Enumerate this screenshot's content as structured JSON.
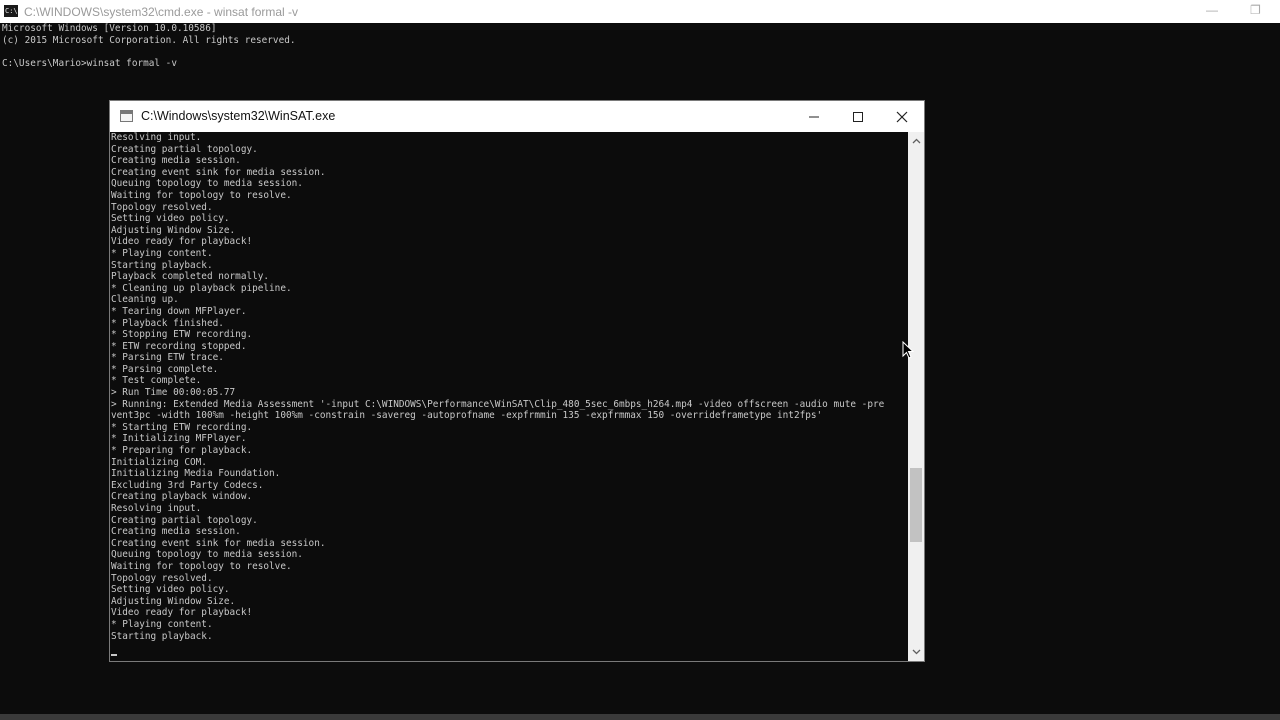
{
  "cmd_window": {
    "title": "C:\\WINDOWS\\system32\\cmd.exe - winsat  formal -v",
    "icon_text": "C:\\",
    "lines": [
      "Microsoft Windows [Version 10.0.10586]",
      "(c) 2015 Microsoft Corporation. All rights reserved.",
      "",
      "C:\\Users\\Mario>winsat formal -v"
    ],
    "controls": {
      "minimize": "—",
      "restore": "❐"
    }
  },
  "winsat_window": {
    "title": "C:\\Windows\\system32\\WinSAT.exe",
    "controls": {
      "minimize": "minimize",
      "maximize": "maximize",
      "close": "close"
    },
    "output_lines": [
      "Resolving input.",
      "Creating partial topology.",
      "Creating media session.",
      "Creating event sink for media session.",
      "Queuing topology to media session.",
      "Waiting for topology to resolve.",
      "Topology resolved.",
      "Setting video policy.",
      "Adjusting Window Size.",
      "Video ready for playback!",
      "* Playing content.",
      "Starting playback.",
      "Playback completed normally.",
      "* Cleaning up playback pipeline.",
      "Cleaning up.",
      "* Tearing down MFPlayer.",
      "* Playback finished.",
      "* Stopping ETW recording.",
      "* ETW recording stopped.",
      "* Parsing ETW trace.",
      "* Parsing complete.",
      "* Test complete.",
      "> Run Time 00:00:05.77",
      "> Running: Extended Media Assessment '-input C:\\WINDOWS\\Performance\\WinSAT\\Clip_480_5sec_6mbps_h264.mp4 -video offscreen -audio mute -pre",
      "vent3pc -width 100%m -height 100%m -constrain -savereg -autoprofname -expfrmmin 135 -expfrmmax 150 -overrideframetype int2fps'",
      "* Starting ETW recording.",
      "* Initializing MFPlayer.",
      "* Preparing for playback.",
      "Initializing COM.",
      "Initializing Media Foundation.",
      "Excluding 3rd Party Codecs.",
      "Creating playback window.",
      "Resolving input.",
      "Creating partial topology.",
      "Creating media session.",
      "Creating event sink for media session.",
      "Queuing topology to media session.",
      "Waiting for topology to resolve.",
      "Topology resolved.",
      "Setting video policy.",
      "Adjusting Window Size.",
      "Video ready for playback!",
      "* Playing content.",
      "Starting playback."
    ]
  }
}
